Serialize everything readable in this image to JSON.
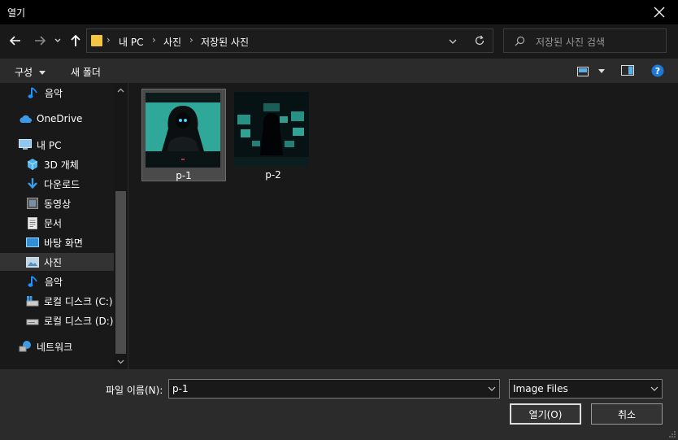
{
  "window": {
    "title": "열기"
  },
  "address": {
    "crumbs": [
      "내 PC",
      "사진",
      "저장된 사진"
    ]
  },
  "search": {
    "placeholder": "저장된 사진 검색"
  },
  "toolbar": {
    "organize_label": "구성",
    "new_folder_label": "새 폴더"
  },
  "sidebar": {
    "items": [
      {
        "label": "음악",
        "icon": "music-icon"
      },
      {
        "label": "OneDrive",
        "icon": "cloud-icon"
      },
      {
        "label": "내 PC",
        "icon": "pc-icon"
      },
      {
        "label": "3D 개체",
        "icon": "cube-icon"
      },
      {
        "label": "다운로드",
        "icon": "download-icon"
      },
      {
        "label": "동영상",
        "icon": "video-icon"
      },
      {
        "label": "문서",
        "icon": "document-icon"
      },
      {
        "label": "바탕 화면",
        "icon": "desktop-icon"
      },
      {
        "label": "사진",
        "icon": "pictures-icon",
        "selected": true
      },
      {
        "label": "음악",
        "icon": "music-icon"
      },
      {
        "label": "로컬 디스크 (C:)",
        "icon": "drive-icon"
      },
      {
        "label": "로컬 디스크 (D:)",
        "icon": "drive-icon"
      },
      {
        "label": "네트워크",
        "icon": "network-icon"
      }
    ]
  },
  "files": [
    {
      "name": "p-1",
      "selected": true
    },
    {
      "name": "p-2",
      "selected": false
    }
  ],
  "footer": {
    "filename_label": "파일 이름(N):",
    "filename_value": "p-1",
    "filetype_value": "Image Files",
    "open_label": "열기(O)",
    "cancel_label": "취소"
  },
  "colors": {
    "accent": "#1e90ff",
    "folder": "#f4c542",
    "thumb_teal": "#2fa89a"
  }
}
